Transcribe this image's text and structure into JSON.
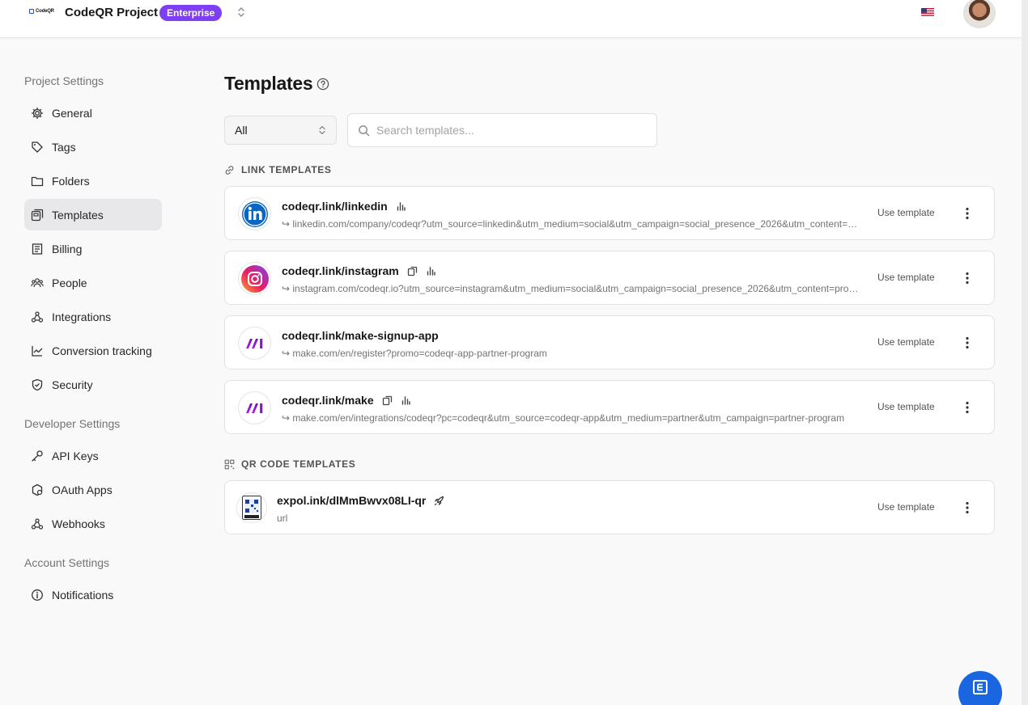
{
  "app": {
    "logo_text": "CodeQR",
    "project_name": "CodeQR Project",
    "plan_badge": "Enterprise",
    "brand_color": "#7e3ff2",
    "accent_color": "#1a66e0"
  },
  "sidebar": {
    "project_section": "Project Settings",
    "project_items": [
      {
        "label": "General",
        "icon": "gear-icon"
      },
      {
        "label": "Tags",
        "icon": "tag-icon"
      },
      {
        "label": "Folders",
        "icon": "folder-icon"
      },
      {
        "label": "Templates",
        "icon": "templates-icon",
        "active": true
      },
      {
        "label": "Billing",
        "icon": "receipt-icon"
      },
      {
        "label": "People",
        "icon": "people-icon"
      },
      {
        "label": "Integrations",
        "icon": "integrations-icon"
      },
      {
        "label": "Conversion tracking",
        "icon": "chart-line-icon"
      },
      {
        "label": "Security",
        "icon": "shield-icon"
      }
    ],
    "developer_section": "Developer Settings",
    "developer_items": [
      {
        "label": "API Keys",
        "icon": "key-icon"
      },
      {
        "label": "OAuth Apps",
        "icon": "oauth-icon"
      },
      {
        "label": "Webhooks",
        "icon": "webhook-icon"
      }
    ],
    "account_section": "Account Settings",
    "account_items": [
      {
        "label": "Notifications",
        "icon": "info-icon"
      }
    ]
  },
  "main": {
    "title": "Templates",
    "filter": {
      "selected": "All"
    },
    "search": {
      "placeholder": "Search templates...",
      "value": ""
    },
    "link_section": "LINK TEMPLATES",
    "qr_section": "QR CODE TEMPLATES",
    "use_label": "Use template",
    "link_templates": [
      {
        "title": "codeqr.link/linkedin",
        "url": "linkedin.com/company/codeqr?utm_source=linkedin&utm_medium=social&utm_campaign=social_presence_2026&utm_content=profile",
        "thumb": "linkedin-logo",
        "copy_icon": false,
        "stats_icon": true
      },
      {
        "title": "codeqr.link/instagram",
        "url": "instagram.com/codeqr.io?utm_source=instagram&utm_medium=social&utm_campaign=social_presence_2026&utm_content=profile",
        "thumb": "instagram-logo",
        "copy_icon": true,
        "stats_icon": true
      },
      {
        "title": "codeqr.link/make-signup-app",
        "url": "make.com/en/register?promo=codeqr-app-partner-program",
        "thumb": "make-logo",
        "copy_icon": false,
        "stats_icon": false
      },
      {
        "title": "codeqr.link/make",
        "url": "make.com/en/integrations/codeqr?pc=codeqr&utm_source=codeqr-app&utm_medium=partner&utm_campaign=partner-program",
        "thumb": "make-logo",
        "copy_icon": true,
        "stats_icon": true
      }
    ],
    "qr_templates": [
      {
        "title": "expol.ink/dlMmBwvx08LI-qr",
        "url": "url",
        "thumb": "qr-code-image"
      }
    ]
  }
}
